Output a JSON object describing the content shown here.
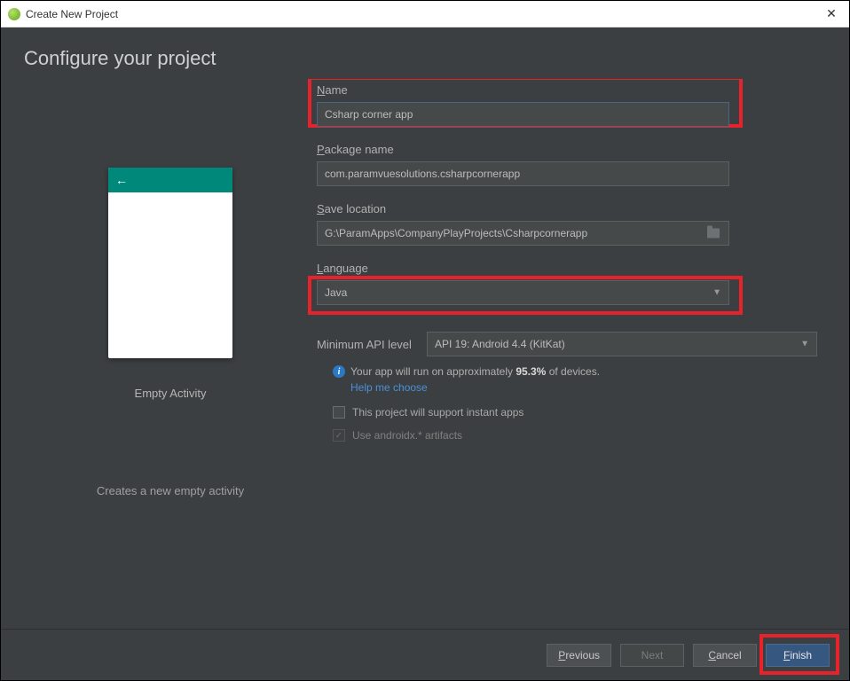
{
  "window": {
    "title": "Create New Project",
    "close": "✕"
  },
  "header": "Configure your project",
  "preview": {
    "title": "Empty Activity",
    "description": "Creates a new empty activity",
    "back_arrow": "←"
  },
  "form": {
    "name": {
      "label": "Name",
      "value": "Csharp corner app"
    },
    "package": {
      "label": "Package name",
      "value": "com.paramvuesolutions.csharpcornerapp"
    },
    "save": {
      "label": "Save location",
      "value": "G:\\ParamApps\\CompanyPlayProjects\\Csharpcornerapp"
    },
    "language": {
      "label": "Language",
      "value": "Java"
    },
    "api": {
      "label": "Minimum API level",
      "value": "API 19: Android 4.4 (KitKat)"
    },
    "info_prefix": "Your app will run on approximately ",
    "info_percent": "95.3%",
    "info_suffix": " of devices.",
    "help_link": "Help me choose",
    "instant_apps": "This project will support instant apps",
    "androidx": "Use androidx.* artifacts"
  },
  "buttons": {
    "previous": "Previous",
    "next": "Next",
    "cancel": "Cancel",
    "finish": "Finish"
  }
}
